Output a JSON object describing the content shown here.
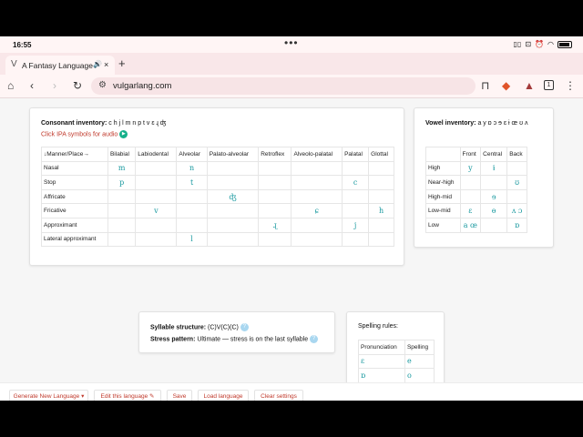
{
  "status": {
    "time": "16:55",
    "menu_dots": "•••"
  },
  "tab": {
    "title": "A Fantasy Language",
    "audio_icon": "🔊",
    "close": "×",
    "new_tab": "+"
  },
  "address": {
    "url": "vulgarlang.com",
    "tab_count": "1"
  },
  "consonants": {
    "inventory_label": "Consonant inventory:",
    "inventory": "c h j l m n p t v ɛ ɻ ʤ",
    "audio_hint": "Click IPA symbols for audio",
    "corner": "↓Manner/Place→",
    "places": [
      "Bilabial",
      "Labiodental",
      "Alveolar",
      "Palato-alveolar",
      "Retroflex",
      "Alveolo-palatal",
      "Palatal",
      "Glottal"
    ],
    "rows": [
      {
        "manner": "Nasal",
        "cells": [
          "m",
          "",
          "n",
          "",
          "",
          "",
          "",
          ""
        ]
      },
      {
        "manner": "Stop",
        "cells": [
          "p",
          "",
          "t",
          "",
          "",
          "",
          "c",
          ""
        ]
      },
      {
        "manner": "Affricate",
        "cells": [
          "",
          "",
          "",
          "ʤ",
          "",
          "",
          "",
          ""
        ]
      },
      {
        "manner": "Fricative",
        "cells": [
          "",
          "v",
          "",
          "",
          "",
          "ɕ",
          "",
          "h"
        ]
      },
      {
        "manner": "Approximant",
        "cells": [
          "",
          "",
          "",
          "",
          "ɻ",
          "",
          "j",
          ""
        ]
      },
      {
        "manner": "Lateral approximant",
        "cells": [
          "",
          "",
          "l",
          "",
          "",
          "",
          "",
          ""
        ]
      }
    ]
  },
  "vowels": {
    "inventory_label": "Vowel inventory:",
    "inventory": "a y ɒ ɔ ɘ ɛ ɨ œ ʊ ʌ",
    "cols": [
      "Front",
      "Central",
      "Back"
    ],
    "rows": [
      {
        "height": "High",
        "cells": [
          "y",
          "ɨ",
          ""
        ]
      },
      {
        "height": "Near-high",
        "cells": [
          "",
          "",
          "ʊ"
        ]
      },
      {
        "height": "High-mid",
        "cells": [
          "",
          "ɘ",
          ""
        ]
      },
      {
        "height": "Low-mid",
        "cells": [
          "ɛ",
          "ɵ",
          "ʌ ɔ"
        ]
      },
      {
        "height": "Low",
        "cells": [
          "a œ",
          "",
          "ɒ"
        ]
      }
    ]
  },
  "syllable": {
    "structure_label": "Syllable structure:",
    "structure": "(C)V(C)(C)",
    "stress_label": "Stress pattern:",
    "stress": "Ultimate — stress is on the last syllable",
    "help": "?"
  },
  "spelling": {
    "title": "Spelling rules:",
    "headers": [
      "Pronunciation",
      "Spelling"
    ],
    "rows": [
      [
        "ɛ",
        "e"
      ],
      [
        "ɒ",
        "o"
      ]
    ]
  },
  "toolbar": {
    "generate": "Generate New Language",
    "edit": "Edit this language",
    "save": "Save",
    "load": "Load language",
    "clear": "Clear settings"
  },
  "colors": {
    "accent": "#c0392b",
    "ipa": "#1b9aa0",
    "help": "#a9d7f0"
  }
}
